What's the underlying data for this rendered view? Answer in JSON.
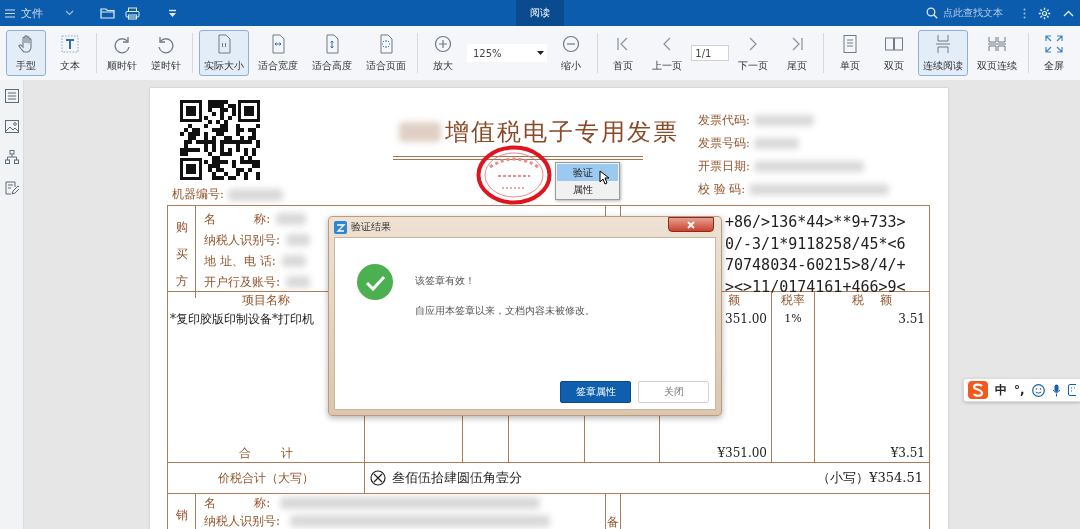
{
  "title_bar": {
    "menu_label": "文件",
    "tabs": [
      {
        "label": "阅读",
        "selected": true
      }
    ],
    "search": {
      "placeholder": "点此查找文本"
    }
  },
  "toolbar": {
    "groups": [
      [
        {
          "kind": "button",
          "label": "手型",
          "selected": true
        },
        {
          "kind": "button",
          "label": "文本",
          "selected": false
        }
      ],
      [
        {
          "kind": "button",
          "label": "顺时针",
          "selected": false
        },
        {
          "kind": "button",
          "label": "逆时针",
          "selected": false
        }
      ],
      [
        {
          "kind": "button",
          "label": "实际大小",
          "selected": true
        },
        {
          "kind": "button",
          "label": "适合宽度",
          "selected": false
        },
        {
          "kind": "button",
          "label": "适合高度",
          "selected": false
        },
        {
          "kind": "button",
          "label": "适合页面",
          "selected": false
        }
      ],
      [
        {
          "kind": "button",
          "label": "放大",
          "selected": false
        },
        {
          "kind": "zoom",
          "value": "125%"
        },
        {
          "kind": "button",
          "label": "缩小",
          "selected": false
        }
      ],
      [
        {
          "kind": "button",
          "label": "首页",
          "selected": false
        },
        {
          "kind": "button",
          "label": "上一页",
          "selected": false
        },
        {
          "kind": "page",
          "value": "1/1"
        },
        {
          "kind": "button",
          "label": "下一页",
          "selected": false
        },
        {
          "kind": "button",
          "label": "尾页",
          "selected": false
        }
      ],
      [
        {
          "kind": "button",
          "label": "单页",
          "selected": false
        },
        {
          "kind": "button",
          "label": "双页",
          "selected": false
        },
        {
          "kind": "button",
          "label": "连续阅读",
          "selected": true
        },
        {
          "kind": "button",
          "label": "双页连续",
          "selected": false
        }
      ],
      [
        {
          "kind": "button",
          "label": "全屏",
          "selected": false
        }
      ]
    ]
  },
  "invoice": {
    "title": "增值税电子专用发票",
    "machine_number_label": "机器编号:",
    "header_fields": [
      "发票代码:",
      "发票号码:",
      "开票日期:",
      "校 验 码:"
    ],
    "buyer": {
      "side_label": "购买方",
      "fields": [
        "名          称:",
        "纳税人识别号:",
        "地 址、电 话:",
        "开户行及账号:"
      ]
    },
    "cipher_lines": [
      "+86/>136*44>**9+733>",
      "0/-3/1*9118258/45*<6",
      "70748034-60215>8/4/+",
      "><>11/0174161+466>9<"
    ],
    "items": {
      "header": {
        "column_1": "项目名称",
        "column_6": "额",
        "column_7": "税率",
        "column_8": "税    额"
      },
      "rows": [
        {
          "column_1": "*复印胶版印制设备*打印机",
          "column_6": "351.00",
          "column_7": "1%",
          "column_8": "3.51"
        }
      ],
      "total": {
        "column_1": "合        计",
        "column_6": "¥351.00",
        "column_8": "¥3.51"
      }
    },
    "grand_total": {
      "label": "价税合计（大写）",
      "words": "叁佰伍拾肆圆伍角壹分",
      "figures": "（小写）¥354.51"
    },
    "seller": {
      "side_label": "销",
      "fields": [
        "名          称:",
        "纳税人识别号:"
      ],
      "remarks_label": "备"
    }
  },
  "context_menu": {
    "items": [
      {
        "label": "验证",
        "selected": true
      },
      {
        "label": "属性",
        "selected": false
      }
    ]
  },
  "dialog": {
    "title": "验证结果",
    "message": "该签章有效！",
    "detail": "自应用本签章以来，文档内容未被修改。",
    "buttons": [
      {
        "label": "签章属性",
        "primary": true
      },
      {
        "label": "关闭",
        "primary": false
      }
    ]
  },
  "ime_bar": {
    "items": [
      "中",
      "°,"
    ]
  }
}
